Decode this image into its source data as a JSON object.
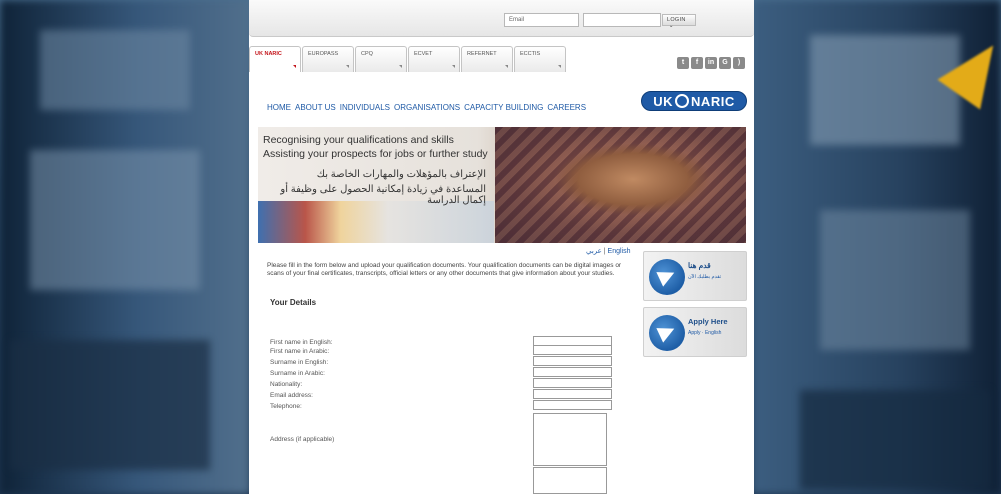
{
  "login": {
    "email_placeholder": "Email",
    "password_placeholder": "",
    "login_label": "LOGIN"
  },
  "tabs": [
    "UK NARIC",
    "EUROPASS",
    "CPQ",
    "ECVET",
    "REFERNET",
    "ECCTIS"
  ],
  "social": [
    "t",
    "f",
    "in",
    "G",
    "rss"
  ],
  "nav": [
    "HOME",
    "ABOUT US",
    "INDIVIDUALS",
    "ORGANISATIONS",
    "CAPACITY BUILDING",
    "CAREERS"
  ],
  "logo": {
    "left": "UK",
    "right": "NARIC"
  },
  "banner": {
    "line1": "Recognising your qualifications and skills",
    "line2": "Assisting your prospects for jobs or further study",
    "arabic1": "الإعتراف بالمؤهلات والمهارات الخاصة بك",
    "arabic2": "المساعدة في زيادة إمكانية الحصول على وظيفة أو إكمال الدراسة"
  },
  "language": {
    "arabic": "عربي",
    "english": "English"
  },
  "intro": "Please fill in the form below and upload your qualification documents. Your qualification documents can be digital images or scans of your final certificates, transcripts, official letters or any other documents that give information about your studies.",
  "section_title": "Your Details",
  "fields": [
    "First name in English:",
    "First name in Arabic:",
    "Surname in English:",
    "Surname in Arabic:",
    "Nationality:",
    "Email address:",
    "Telephone:"
  ],
  "address_label": "Address (if applicable)",
  "side_cards": {
    "arabic_title": "قدم هنا",
    "arabic_sub": "تقدم بطلبك الآن",
    "english_title": "Apply Here",
    "english_sub": "Apply · English"
  }
}
